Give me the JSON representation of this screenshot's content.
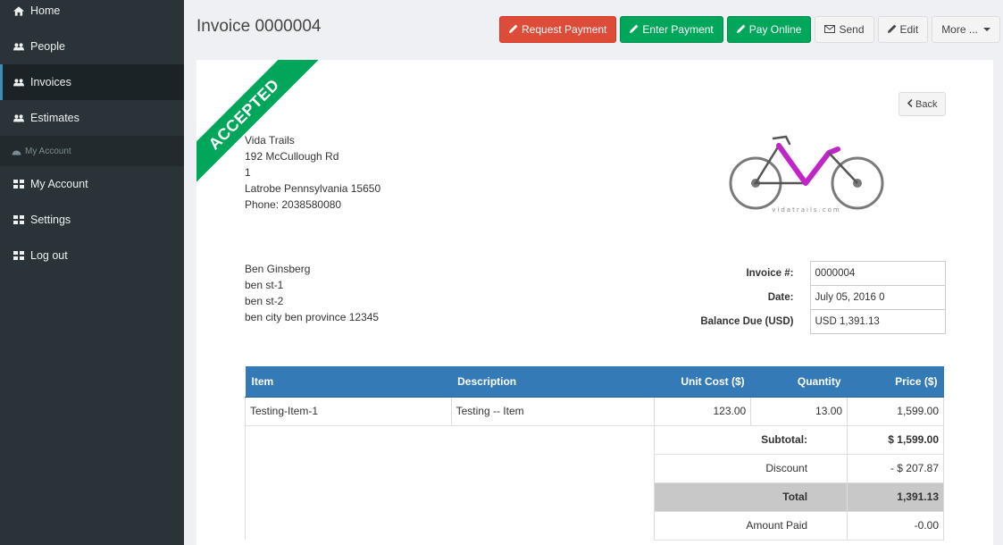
{
  "sidebar": {
    "items": [
      {
        "label": "Home",
        "icon": "home-icon"
      },
      {
        "label": "People",
        "icon": "users-icon"
      },
      {
        "label": "Invoices",
        "icon": "users-icon"
      },
      {
        "label": "Estimates",
        "icon": "users-icon"
      }
    ],
    "section_header": "My Account",
    "account_items": [
      {
        "label": "My Account",
        "icon": "grid-icon"
      },
      {
        "label": "Settings",
        "icon": "grid-icon"
      },
      {
        "label": "Log out",
        "icon": "grid-icon"
      }
    ]
  },
  "header": {
    "title": "Invoice 0000004"
  },
  "toolbar": {
    "request_payment": "Request Payment",
    "enter_payment": "Enter Payment",
    "pay_online": "Pay Online",
    "send": "Send",
    "edit": "Edit",
    "more": "More ..."
  },
  "invoice": {
    "status": "ACCEPTED",
    "back_label": "Back",
    "sender": {
      "name": "Vida Trails",
      "street": "192 McCullough Rd",
      "line2": "1",
      "city": "Latrobe Pennsylvania 15650",
      "phone": "Phone: 2038580080"
    },
    "logo_text": "vidatrails.com",
    "client": {
      "name": "Ben Ginsberg",
      "line1": "ben st-1",
      "line2": "ben st-2",
      "city": "ben city ben province 12345"
    },
    "meta": {
      "number_label": "Invoice #:",
      "number": "0000004",
      "date_label": "Date:",
      "date": "July 05, 2016 0",
      "balance_label": "Balance Due (USD)",
      "balance": "USD 1,391.13"
    },
    "columns": {
      "item": "Item",
      "description": "Description",
      "unit_cost": "Unit Cost ($)",
      "quantity": "Quantity",
      "price": "Price ($)"
    },
    "lines": [
      {
        "item": "Testing-Item-1",
        "description": "Testing -- Item",
        "unit_cost": "123.00",
        "quantity": "13.00",
        "price": "1,599.00"
      }
    ],
    "totals": {
      "subtotal_label": "Subtotal:",
      "subtotal": "$ 1,599.00",
      "discount_label": "Discount",
      "discount": "- $ 207.87",
      "total_label": "Total",
      "total": "1,391.13",
      "paid_label": "Amount Paid",
      "paid": "-0.00"
    }
  },
  "colors": {
    "sidebar_bg": "#2a3338",
    "danger": "#dd4b39",
    "success": "#00a65a",
    "table_header": "#337ab7",
    "logo_accent": "#c026c7"
  }
}
